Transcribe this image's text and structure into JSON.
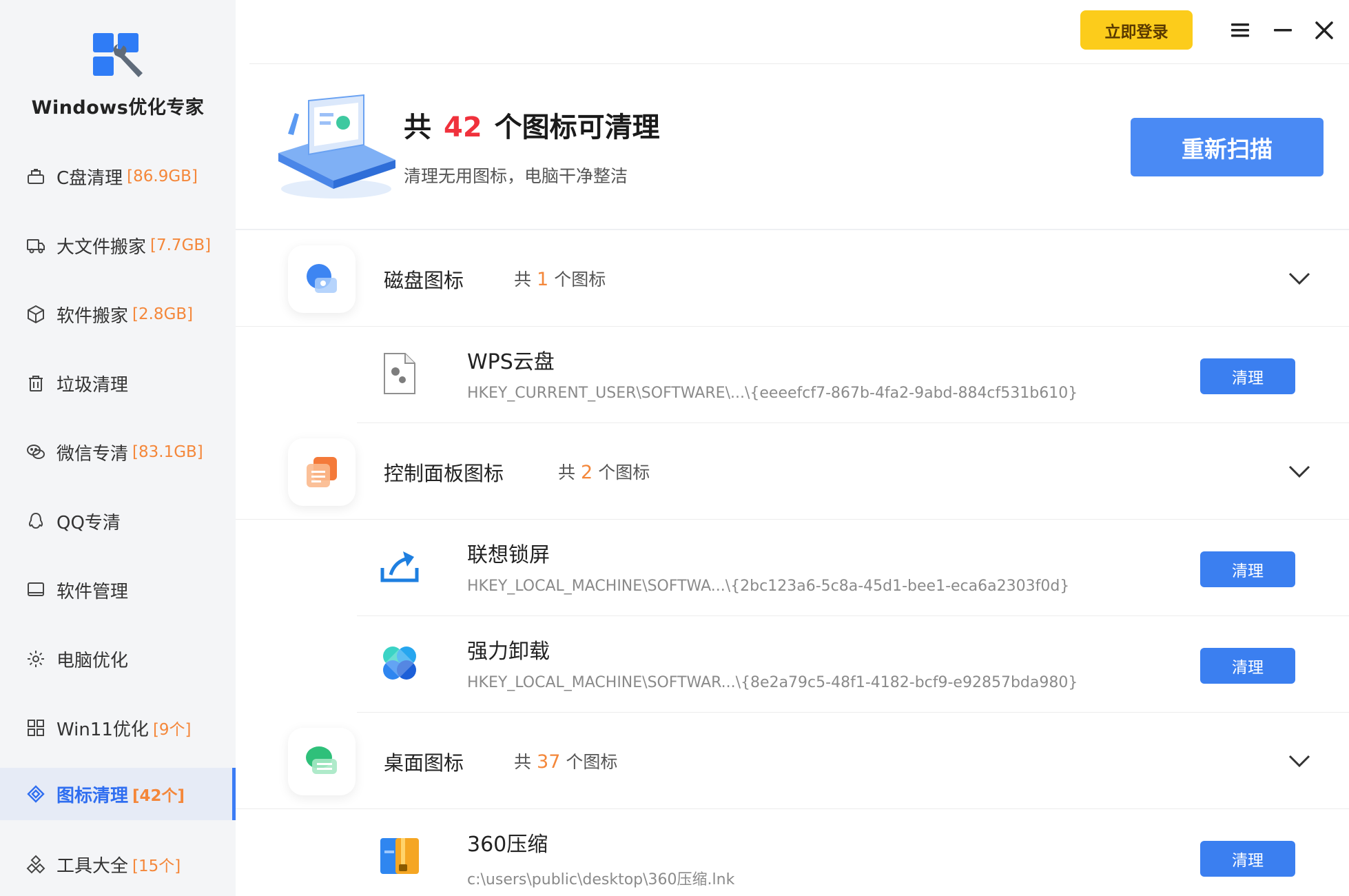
{
  "app": {
    "title": "Windows优化专家"
  },
  "sidebar": {
    "items": [
      {
        "label": "C盘清理",
        "badge": "[86.9GB]"
      },
      {
        "label": "大文件搬家",
        "badge": "[7.7GB]"
      },
      {
        "label": "软件搬家",
        "badge": "[2.8GB]"
      },
      {
        "label": "垃圾清理",
        "badge": ""
      },
      {
        "label": "微信专清",
        "badge": "[83.1GB]"
      },
      {
        "label": "QQ专清",
        "badge": ""
      },
      {
        "label": "软件管理",
        "badge": ""
      },
      {
        "label": "电脑优化",
        "badge": ""
      },
      {
        "label": "Win11优化",
        "badge": "[9个]"
      },
      {
        "label": "图标清理",
        "badge": "[42个]"
      },
      {
        "label": "工具大全",
        "badge": "[15个]"
      }
    ],
    "active_index": 9
  },
  "topbar": {
    "login_label": "立即登录"
  },
  "header": {
    "prefix": "共",
    "count": "42",
    "suffix": "个图标可清理",
    "subtitle": "清理无用图标，电脑干净整洁",
    "rescan_label": "重新扫描"
  },
  "groups": [
    {
      "title": "磁盘图标",
      "count_prefix": "共",
      "count": "1",
      "count_suffix": "个图标",
      "items": [
        {
          "name": "WPS云盘",
          "path": "HKEY_CURRENT_USER\\SOFTWARE\\...\\{eeeefcf7-867b-4fa2-9abd-884cf531b610}",
          "action": "清理",
          "icon": "settings-file-icon"
        }
      ]
    },
    {
      "title": "控制面板图标",
      "count_prefix": "共",
      "count": "2",
      "count_suffix": "个图标",
      "items": [
        {
          "name": "联想锁屏",
          "path": "HKEY_LOCAL_MACHINE\\SOFTWA...\\{2bc123a6-5c8a-45d1-bee1-eca6a2303f0d}",
          "action": "清理",
          "icon": "share-arrow-icon"
        },
        {
          "name": "强力卸载",
          "path": "HKEY_LOCAL_MACHINE\\SOFTWAR...\\{8e2a79c5-48f1-4182-bcf9-e92857bda980}",
          "action": "清理",
          "icon": "uninstall-clover-icon"
        }
      ]
    },
    {
      "title": "桌面图标",
      "count_prefix": "共",
      "count": "37",
      "count_suffix": "个图标",
      "items": [
        {
          "name": "360压缩",
          "path": "c:\\users\\public\\desktop\\360压缩.lnk",
          "action": "清理",
          "icon": "archive-icon"
        }
      ]
    }
  ],
  "colors": {
    "accent": "#4a8af4",
    "count_red": "#f0313c",
    "badge_orange": "#f4873a",
    "login_yellow": "#fccc1b"
  }
}
